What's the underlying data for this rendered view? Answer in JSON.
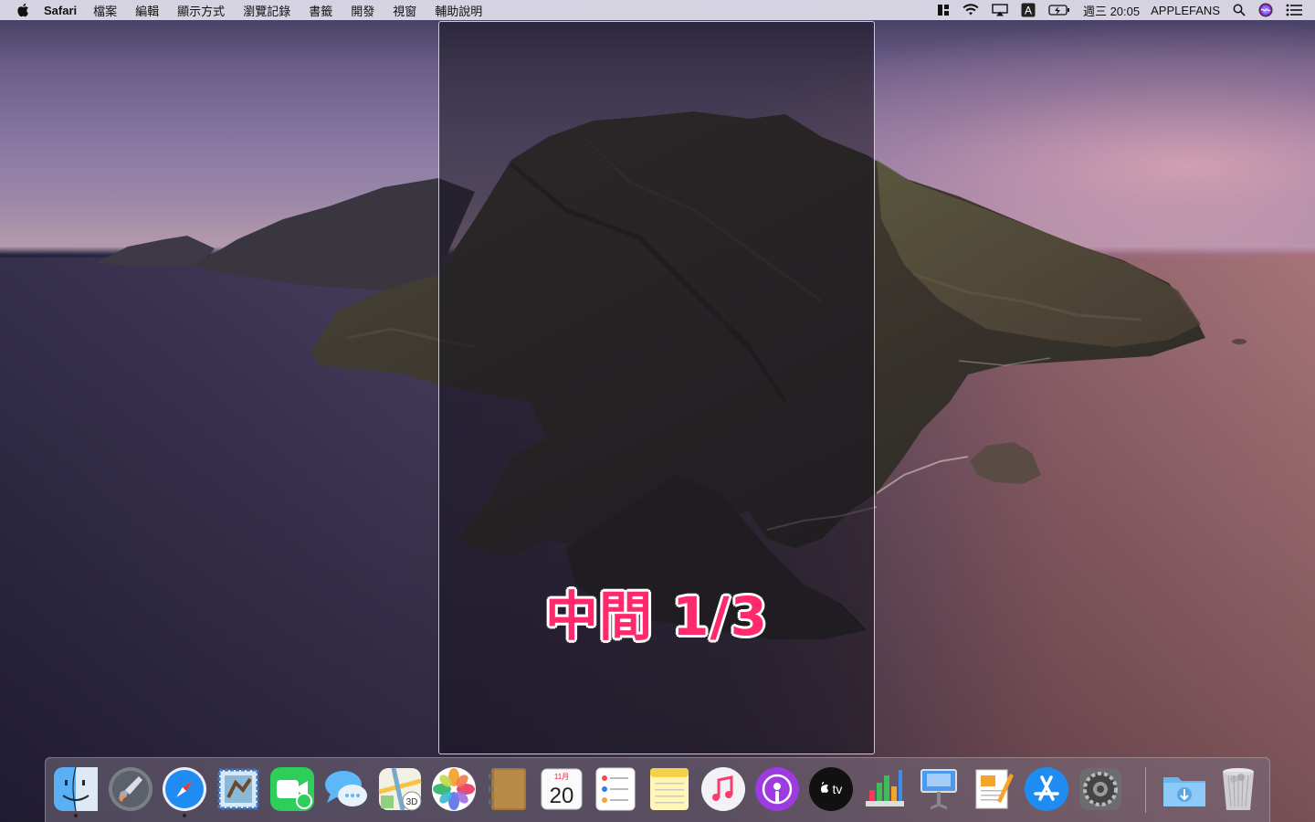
{
  "menubar": {
    "app_name": "Safari",
    "menus": [
      "檔案",
      "編輯",
      "顯示方式",
      "瀏覽記錄",
      "書籤",
      "開發",
      "視窗",
      "輔助說明"
    ],
    "input_source": "A",
    "clock": "週三 20:05",
    "user": "APPLEFANS",
    "status_icons": [
      "magnet-icon",
      "wifi-icon",
      "airplay-icon",
      "input-source-icon",
      "battery-icon",
      "spotlight-icon",
      "siri-icon",
      "notification-center-icon"
    ]
  },
  "snap": {
    "label": "中間 1/3",
    "label_color": "#ff2a6d"
  },
  "dock": {
    "apps": [
      {
        "name": "finder",
        "running": true
      },
      {
        "name": "launchpad",
        "running": false
      },
      {
        "name": "safari",
        "running": true
      },
      {
        "name": "mail",
        "running": false
      },
      {
        "name": "facetime",
        "running": false
      },
      {
        "name": "messages",
        "running": false
      },
      {
        "name": "maps",
        "running": false
      },
      {
        "name": "photos",
        "running": false
      },
      {
        "name": "contacts",
        "running": false
      },
      {
        "name": "calendar",
        "running": false
      },
      {
        "name": "reminders",
        "running": false
      },
      {
        "name": "notes",
        "running": false
      },
      {
        "name": "music",
        "running": false
      },
      {
        "name": "podcasts",
        "running": false
      },
      {
        "name": "tv",
        "running": false
      },
      {
        "name": "numbers",
        "running": false
      },
      {
        "name": "keynote",
        "running": false
      },
      {
        "name": "pages",
        "running": false
      },
      {
        "name": "app-store",
        "running": false
      },
      {
        "name": "system-preferences",
        "running": false
      },
      {
        "name": "downloads",
        "running": false
      },
      {
        "name": "trash",
        "running": false
      }
    ],
    "calendar": {
      "month": "11月",
      "day": "20"
    },
    "maps_badge": "3D",
    "tv_label": "tv"
  }
}
